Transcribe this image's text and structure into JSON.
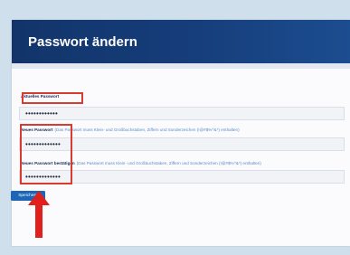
{
  "header": {
    "title": "Passwort ändern"
  },
  "form": {
    "current": {
      "label": "Aktuelles Passwort",
      "value": "••••••••••••"
    },
    "new": {
      "label": "Neues Passwort",
      "hint": "(Das Passwort muss Klein- und Großbuchstaben, Ziffern und Sonderzeichen (!@#$%^&*) enthalten)",
      "value": "•••••••••••••"
    },
    "confirm": {
      "label": "Neues Passwort bestätigen",
      "hint": "(Das Passwort muss Klein- und Großbuchstaben, Ziffern und Sonderzeichen (!@#$%^&*) enthalten)",
      "value": "•••••••••••••"
    },
    "save_label": "Speichern"
  },
  "colors": {
    "header": "#163e7b",
    "highlight": "#d83b30",
    "button": "#1d66b5",
    "arrow": "#e0201c"
  }
}
